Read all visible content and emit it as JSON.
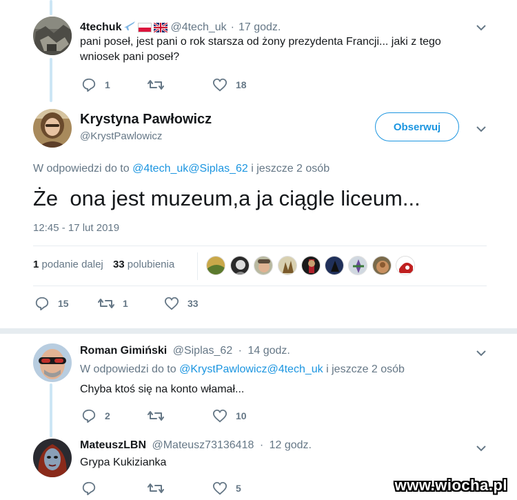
{
  "reply1": {
    "name": "4techuk",
    "handle": "@4tech_uk",
    "dot": "·",
    "time": "17 godz.",
    "text_line1": "pani poseł, jest pani o rok starsza od żony prezydenta Francji... jaki z tego",
    "text_line2": "wniosek pani poseł?",
    "replies": "1",
    "likes": "18"
  },
  "main": {
    "name": "Krystyna Pawłowicz",
    "handle": "@KrystPawlowicz",
    "follow_label": "Obserwuj",
    "reply_to_prefix": "W odpowiedzi do to",
    "reply_to_link": "@4tech_uk@Siplas_62",
    "reply_to_suffix": "i jeszcze 2 osób",
    "text": "Że  ona jest muzeum,a ja ciągle liceum...",
    "timestamp": "12:45 - 17 lut 2019",
    "retweet_count": "1",
    "retweet_label": "podanie dalej",
    "like_count": "33",
    "like_label": "polubienia",
    "replies": "15",
    "retweets": "1",
    "likes": "33"
  },
  "reply2": {
    "name": "Roman Gimiński",
    "handle": "@Siplas_62",
    "dot": "·",
    "time": "14 godz.",
    "reply_to_prefix": "W odpowiedzi do to",
    "reply_to_link": "@KrystPawlowicz@4tech_uk",
    "reply_to_suffix": "i jeszcze 2 osób",
    "text": "Chyba ktoś się na konto włamał...",
    "replies": "2",
    "likes": "10"
  },
  "reply3": {
    "name": "MateuszLBN",
    "handle": "@Mateusz73136418",
    "dot": "·",
    "time": "12 godz.",
    "text": "Grypa Kukizianka",
    "likes": "5"
  },
  "watermark": "www.wiocha.pl",
  "colors": {
    "accent": "#1b95e0",
    "muted": "#657786",
    "thread_line": "#cce6f5"
  }
}
